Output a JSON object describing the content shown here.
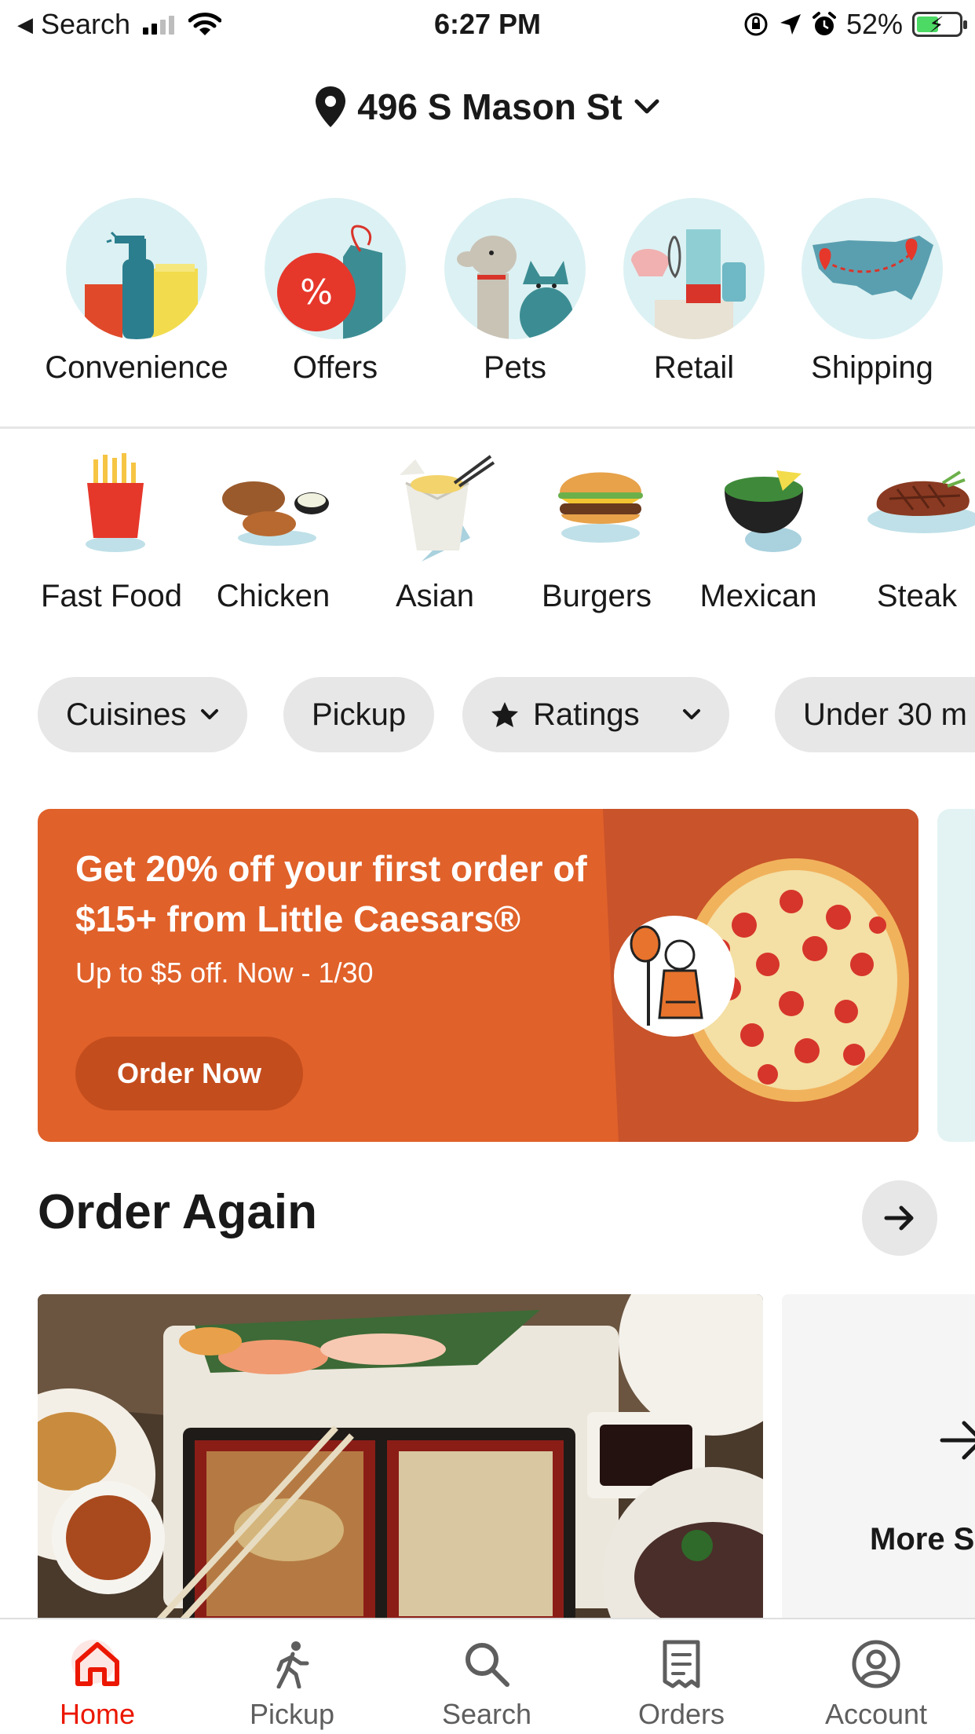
{
  "status_bar": {
    "back_label": "Search",
    "time": "6:27 PM",
    "battery_percent": "52%",
    "battery_level": 0.52,
    "icons": [
      "back-arrow-icon",
      "cellular-signal-icon",
      "wifi-icon",
      "orientation-lock-icon",
      "location-arrow-icon",
      "alarm-icon",
      "battery-charging-icon"
    ]
  },
  "header": {
    "address": "496 S Mason St",
    "icons": [
      "location-pin-icon",
      "chevron-down-icon"
    ]
  },
  "categories": [
    {
      "label": "Convenience",
      "icon": "cleaning-supplies-icon"
    },
    {
      "label": "Offers",
      "icon": "discount-tag-icon"
    },
    {
      "label": "Pets",
      "icon": "dog-cat-icon"
    },
    {
      "label": "Retail",
      "icon": "home-goods-icon"
    },
    {
      "label": "Shipping",
      "icon": "us-map-icon"
    }
  ],
  "cuisines": [
    {
      "label": "Fast Food",
      "icon": "fries-icon"
    },
    {
      "label": "Chicken",
      "icon": "chicken-icon"
    },
    {
      "label": "Asian",
      "icon": "takeout-box-icon"
    },
    {
      "label": "Burgers",
      "icon": "burger-icon"
    },
    {
      "label": "Mexican",
      "icon": "guacamole-icon"
    },
    {
      "label": "Steak",
      "icon": "steak-icon"
    }
  ],
  "filters": [
    {
      "label": "Cuisines",
      "icon": "chevron-down-icon"
    },
    {
      "label": "Pickup"
    },
    {
      "label": "Ratings",
      "icon": "star-icon"
    },
    {
      "label": "Under 30 m"
    }
  ],
  "promo": {
    "title": "Get 20% off your first order of $15+ from Little Caesars®",
    "subtitle": "Up to $5 off. Now - 1/30",
    "button_label": "Order Now",
    "background_color": "#e0612a"
  },
  "order_again": {
    "title": "Order Again",
    "more_label": "More S",
    "icons": [
      "arrow-right-icon"
    ]
  },
  "tab_bar": {
    "tabs": [
      {
        "label": "Home",
        "icon": "home-icon",
        "active": true
      },
      {
        "label": "Pickup",
        "icon": "walking-person-icon",
        "active": false
      },
      {
        "label": "Search",
        "icon": "search-icon",
        "active": false
      },
      {
        "label": "Orders",
        "icon": "receipt-icon",
        "active": false
      },
      {
        "label": "Account",
        "icon": "user-circle-icon",
        "active": false
      }
    ],
    "active_color": "#eb1700"
  }
}
